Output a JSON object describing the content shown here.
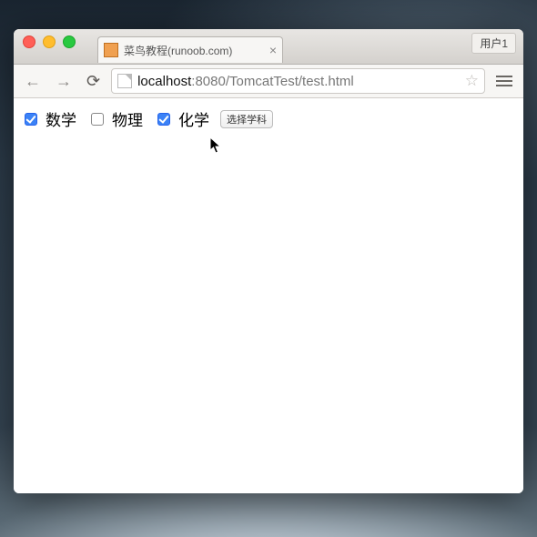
{
  "window": {
    "user_chip": "用户1"
  },
  "tab": {
    "title": "菜鸟教程(runoob.com)"
  },
  "toolbar": {
    "url_host": "localhost",
    "url_port": ":8080",
    "url_path": "/TomcatTest/test.html"
  },
  "page": {
    "checkboxes": [
      {
        "label": "数学",
        "checked": true
      },
      {
        "label": "物理",
        "checked": false
      },
      {
        "label": "化学",
        "checked": true
      }
    ],
    "button_label": "选择学科"
  }
}
